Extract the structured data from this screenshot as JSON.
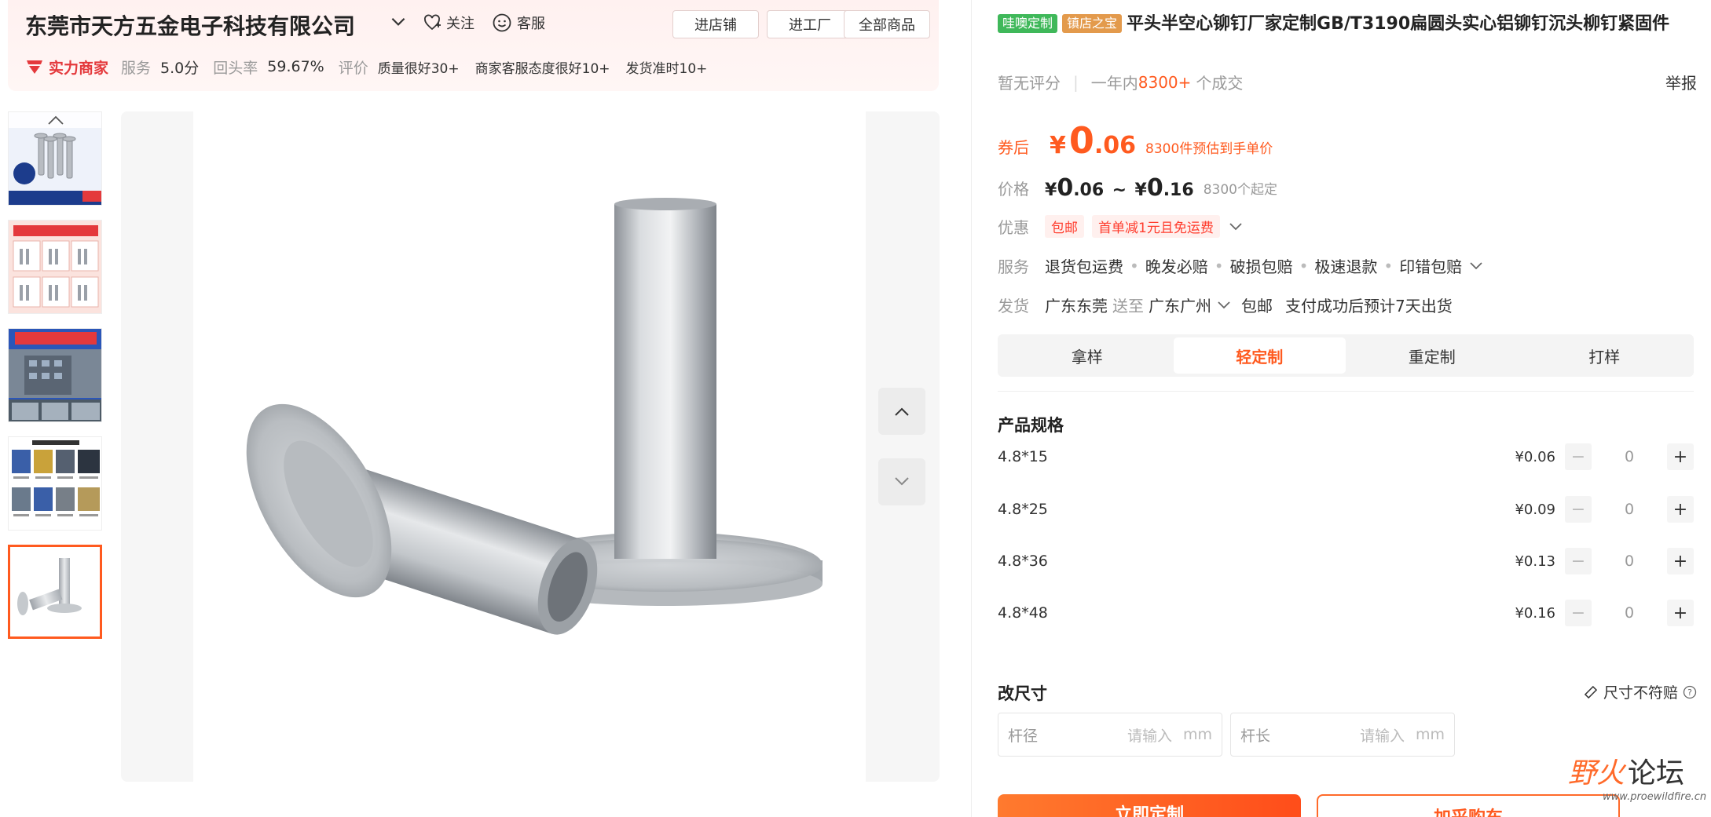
{
  "shop": {
    "name": "东莞市天方五金电子科技有限公司",
    "follow_label": "关注",
    "service_label": "客服",
    "buttons": {
      "enter_shop": "进店铺",
      "enter_factory": "进工厂",
      "all_goods": "全部商品"
    },
    "badge": "实力商家",
    "service_label2": "服务",
    "service_score": "5.0分",
    "repurchase_label": "回头率",
    "repurchase_value": "59.67%",
    "review_label": "评价",
    "review_tags": [
      "质量很好30+",
      "商家客服态度很好10+",
      "发货准时10+"
    ]
  },
  "product": {
    "badges": [
      "哇噢定制",
      "镇店之宝"
    ],
    "title": "平头半空心铆钉厂家定制GB/T3190扁圆头实心铝铆钉沉头柳钉紧固件",
    "rating_text": "暂无评分",
    "deals_prefix": "一年内",
    "deals_num": "8300+",
    "deals_suffix": "个成交",
    "report_label": "举报"
  },
  "coupon": {
    "label": "券后",
    "yen": "¥",
    "int": "0",
    "dec": ".06",
    "note": "8300件预估到手单价"
  },
  "price": {
    "label": "价格",
    "low_yen": "¥",
    "low_int": "0",
    "low_dec": ".06",
    "tilde": "~",
    "high_yen": "¥",
    "high_int": "0",
    "high_dec": ".16",
    "moq": "8300个起定"
  },
  "promo": {
    "label": "优惠",
    "tags": [
      "包邮",
      "首单减1元且免运费"
    ]
  },
  "services": {
    "label": "服务",
    "items": [
      "退货包运费",
      "晚发必赔",
      "破损包赔",
      "极速退款",
      "印错包赔"
    ]
  },
  "shipping": {
    "label": "发货",
    "from": "广东东莞",
    "to_label": "送至",
    "to": "广东广州",
    "free": "包邮",
    "eta": "支付成功后预计7天出货"
  },
  "custom_tabs": [
    "拿样",
    "轻定制",
    "重定制",
    "打样"
  ],
  "custom_tab_active": 1,
  "spec": {
    "title": "产品规格",
    "rows": [
      {
        "name": "4.8*15",
        "price": "¥0.06",
        "qty": "0"
      },
      {
        "name": "4.8*25",
        "price": "¥0.09",
        "qty": "0"
      },
      {
        "name": "4.8*36",
        "price": "¥0.13",
        "qty": "0"
      },
      {
        "name": "4.8*48",
        "price": "¥0.16",
        "qty": "0"
      }
    ],
    "minus": "−",
    "plus": "+"
  },
  "resize": {
    "title": "改尺寸",
    "guarantee": "尺寸不符赔",
    "inputs": [
      {
        "label": "杆径",
        "placeholder": "请输入",
        "unit": "mm"
      },
      {
        "label": "杆长",
        "placeholder": "请输入",
        "unit": "mm"
      }
    ]
  },
  "actions": {
    "customize": "立即定制",
    "cart": "加采购车"
  },
  "watermark": {
    "text1": "野火",
    "text2": "论坛",
    "url": "www.proewildfire.cn"
  },
  "colors": {
    "accent": "#ff5a1f",
    "brand_red": "#e4393c",
    "badge_green": "#3fb85a",
    "badge_orange": "#e39a4c"
  }
}
